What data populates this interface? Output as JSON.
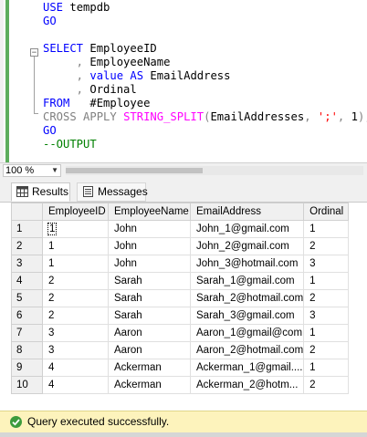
{
  "editor": {
    "lines": [
      {
        "parts": [
          {
            "t": "USE ",
            "c": "kw"
          },
          {
            "t": "tempdb",
            "c": ""
          }
        ]
      },
      {
        "parts": [
          {
            "t": "GO",
            "c": "kw"
          }
        ]
      },
      {
        "parts": []
      },
      {
        "parts": [
          {
            "t": "SELECT ",
            "c": "kw"
          },
          {
            "t": "EmployeeID",
            "c": ""
          }
        ]
      },
      {
        "parts": [
          {
            "t": "     , ",
            "c": "gray"
          },
          {
            "t": "EmployeeName",
            "c": ""
          }
        ]
      },
      {
        "parts": [
          {
            "t": "     , ",
            "c": "gray"
          },
          {
            "t": "value ",
            "c": "kw"
          },
          {
            "t": "AS ",
            "c": "kw"
          },
          {
            "t": "EmailAddress",
            "c": ""
          }
        ]
      },
      {
        "parts": [
          {
            "t": "     , ",
            "c": "gray"
          },
          {
            "t": "Ordinal",
            "c": ""
          }
        ]
      },
      {
        "parts": [
          {
            "t": "FROM   ",
            "c": "kw"
          },
          {
            "t": "#Employee",
            "c": ""
          }
        ]
      },
      {
        "parts": [
          {
            "t": "CROSS APPLY ",
            "c": "gray"
          },
          {
            "t": "STRING_SPLIT",
            "c": "fn"
          },
          {
            "t": "(",
            "c": "gray"
          },
          {
            "t": "EmailAddresses",
            "c": ""
          },
          {
            "t": ", ",
            "c": "gray"
          },
          {
            "t": "';'",
            "c": "str"
          },
          {
            "t": ", ",
            "c": "gray"
          },
          {
            "t": "1",
            "c": ""
          },
          {
            "t": ");",
            "c": "gray"
          }
        ]
      },
      {
        "parts": [
          {
            "t": "GO",
            "c": "kw"
          }
        ]
      },
      {
        "parts": [
          {
            "t": "--OUTPUT",
            "c": "cmt"
          }
        ]
      }
    ]
  },
  "zoom": {
    "value": "100 %"
  },
  "tabs": {
    "results": "Results",
    "messages": "Messages"
  },
  "grid": {
    "columns": [
      "EmployeeID",
      "EmployeeName",
      "EmailAddress",
      "Ordinal"
    ],
    "rows": [
      [
        "1",
        "1",
        "John",
        "John_1@gmail.com",
        "1"
      ],
      [
        "2",
        "1",
        "John",
        "John_2@gmail.com",
        "2"
      ],
      [
        "3",
        "1",
        "John",
        "John_3@hotmail.com",
        "3"
      ],
      [
        "4",
        "2",
        "Sarah",
        "Sarah_1@gmail.com",
        "1"
      ],
      [
        "5",
        "2",
        "Sarah",
        "Sarah_2@hotmail.com",
        "2"
      ],
      [
        "6",
        "2",
        "Sarah",
        "Sarah_3@gmail.com",
        "3"
      ],
      [
        "7",
        "3",
        "Aaron",
        "Aaron_1@gmail@com",
        "1"
      ],
      [
        "8",
        "3",
        "Aaron",
        "Aaron_2@hotmail.com",
        "2"
      ],
      [
        "9",
        "4",
        "Ackerman",
        "Ackerman_1@gmail....",
        "1"
      ],
      [
        "10",
        "4",
        "Ackerman",
        "Ackerman_2@hotm...",
        "2"
      ]
    ]
  },
  "status": {
    "text": "Query executed successfully."
  }
}
